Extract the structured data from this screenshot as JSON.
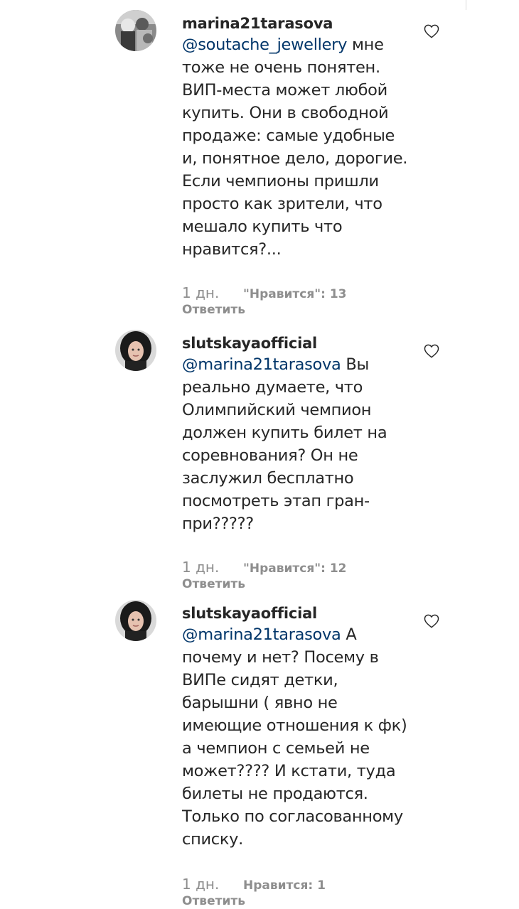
{
  "comments": [
    {
      "username": "marina21tarasova",
      "mention": "@soutache_jewellery",
      "text": " мне тоже не очень понятен. ВИП-места может любой купить. Они в свободной продаже: самые удобные и, понятное дело, дорогие. Если чемпионы пришли просто как зрители, что мешало купить что нравится?...",
      "time": "1 дн.",
      "likes": "\"Нравится\": 13",
      "reply": "Ответить",
      "avatar_icon": "profile-photo",
      "like_icon": "heart-outline-icon"
    },
    {
      "username": "slutskayaofficial",
      "mention": "@marina21tarasova",
      "text": " Вы реально думаете, что Олимпийский чемпион должен купить билет на соревнования? Он не заслужил бесплатно посмотреть этап гран-при?????",
      "time": "1 дн.",
      "likes": "\"Нравится\": 12",
      "reply": "Ответить",
      "avatar_icon": "profile-photo",
      "like_icon": "heart-outline-icon"
    },
    {
      "username": "slutskayaofficial",
      "mention": "@marina21tarasova",
      "text": " А почему и нет? Посему в ВИПе сидят детки, барышни ( явно не имеющие отношения к фк) а чемпион с семьей не может???? И кстати, туда билеты не продаются. Только по согласованному списку.",
      "time": "1 дн.",
      "likes": "Нравится: 1",
      "reply": "Ответить",
      "avatar_icon": "profile-photo",
      "like_icon": "heart-outline-icon"
    }
  ],
  "colors": {
    "text": "#262626",
    "mention": "#003569",
    "meta": "#8e8e8e"
  }
}
